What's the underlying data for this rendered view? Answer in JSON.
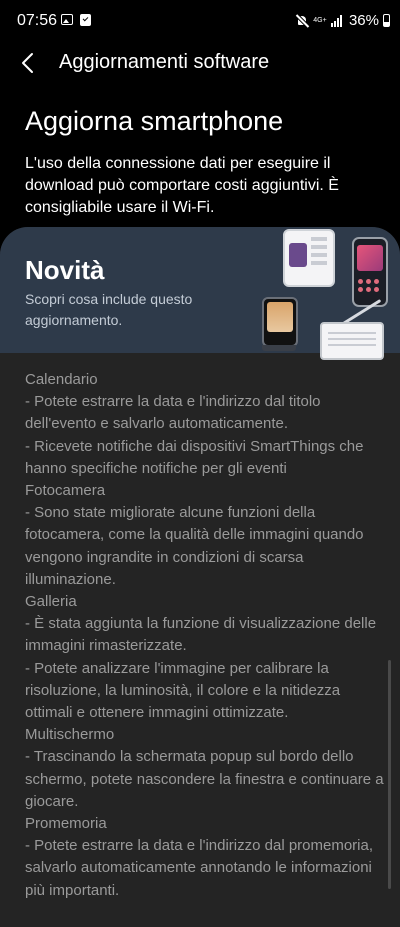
{
  "status_bar": {
    "time": "07:56",
    "network_label": "4G+",
    "battery_percent": "36%"
  },
  "icons": [
    "gallery-icon",
    "task-check-icon",
    "mute-icon",
    "signal-icon",
    "battery-icon",
    "back-arrow-icon"
  ],
  "header": {
    "title": "Aggiornamenti software"
  },
  "page": {
    "heading": "Aggiorna smartphone",
    "intro": "L'uso della connessione dati per eseguire il download può comportare costi aggiuntivi. È consigliabile usare il Wi-Fi."
  },
  "banner": {
    "title": "Novità",
    "subtitle": "Scopri cosa include questo aggiornamento."
  },
  "release_notes": "Calendario\n- Potete estrarre la data e l'indirizzo dal titolo dell'evento e salvarlo automaticamente.\n- Ricevete notifiche dai dispositivi SmartThings che hanno specifiche notifiche per gli eventi\nFotocamera\n- Sono state migliorate alcune funzioni della fotocamera, come la qualità delle immagini quando vengono ingrandite in condizioni di scarsa illuminazione.\nGalleria\n- È stata aggiunta la funzione di visualizzazione delle immagini rimasterizzate.\n- Potete analizzare l'immagine per calibrare la risoluzione, la luminosità, il colore e la nitidezza ottimali e ottenere immagini ottimizzate.\nMultischermo\n- Trascinando la schermata popup sul bordo dello schermo, potete nascondere la finestra e continuare a giocare.\nPromemoria\n- Potete estrarre la data e l'indirizzo dal promemoria, salvarlo automaticamente annotando le informazioni più importanti.",
  "colors": {
    "background": "#000000",
    "panel": "#242424",
    "banner": "#2e3a4a",
    "notes_text": "#9a9a9a"
  }
}
